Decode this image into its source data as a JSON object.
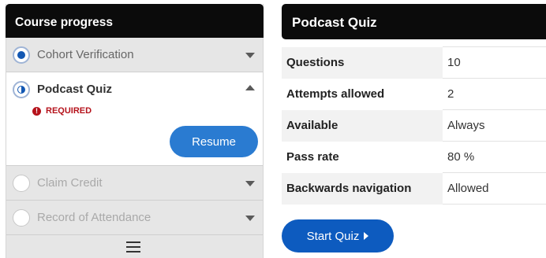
{
  "sidebar": {
    "title": "Course progress",
    "steps": [
      {
        "label": "Cohort Verification",
        "state": "current"
      },
      {
        "label": "Podcast Quiz",
        "state": "in-progress",
        "required_label": "REQUIRED",
        "action_label": "Resume"
      },
      {
        "label": "Claim Credit",
        "state": "disabled"
      },
      {
        "label": "Record of Attendance",
        "state": "disabled"
      }
    ],
    "menu_icon": "hamburger-menu-icon"
  },
  "quiz": {
    "title": "Podcast Quiz",
    "rows": [
      {
        "key": "Questions",
        "value": "10"
      },
      {
        "key": "Attempts allowed",
        "value": "2"
      },
      {
        "key": "Available",
        "value": "Always"
      },
      {
        "key": "Pass rate",
        "value": "80 %"
      },
      {
        "key": "Backwards navigation",
        "value": "Allowed"
      }
    ],
    "start_label": "Start Quiz"
  },
  "colors": {
    "header_bg": "#0b0b0b",
    "primary_button": "#0d5bbf",
    "resume_button": "#2a7bd1",
    "required": "#b5121b"
  }
}
